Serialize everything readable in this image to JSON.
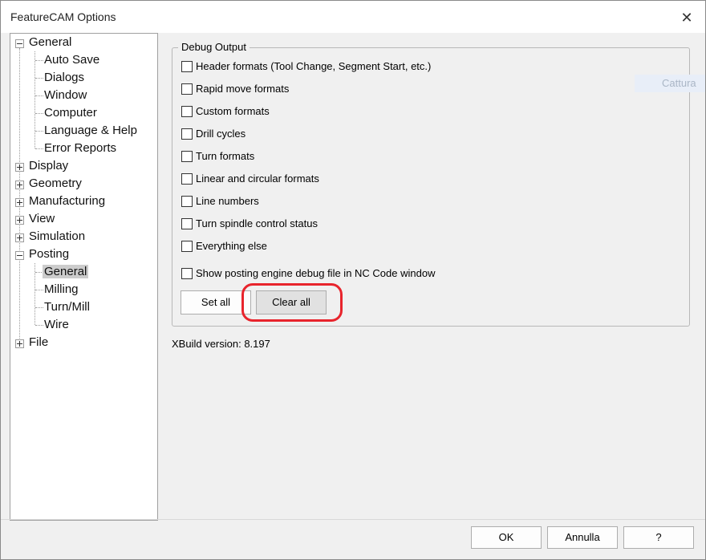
{
  "window": {
    "title": "FeatureCAM Options",
    "close_glyph": "✕"
  },
  "tree": {
    "general": "General",
    "general_children": [
      "Auto Save",
      "Dialogs",
      "Window",
      "Computer",
      "Language & Help",
      "Error Reports"
    ],
    "collapsed": [
      "Display",
      "Geometry",
      "Manufacturing",
      "View",
      "Simulation"
    ],
    "posting": "Posting",
    "posting_children": [
      "General",
      "Milling",
      "Turn/Mill",
      "Wire"
    ],
    "file": "File",
    "selected": "Posting > General"
  },
  "debug_output": {
    "legend": "Debug Output",
    "options": [
      {
        "label": "Header formats (Tool Change, Segment Start, etc.)",
        "checked": false
      },
      {
        "label": "Rapid move formats",
        "checked": false
      },
      {
        "label": "Custom formats",
        "checked": false
      },
      {
        "label": "Drill cycles",
        "checked": false
      },
      {
        "label": "Turn formats",
        "checked": false
      },
      {
        "label": "Linear and circular formats",
        "checked": false
      },
      {
        "label": "Line numbers",
        "checked": false
      },
      {
        "label": "Turn spindle control status",
        "checked": false
      },
      {
        "label": "Everything else",
        "checked": false
      }
    ],
    "nc_option": {
      "label": "Show posting engine debug file in NC Code window",
      "checked": false
    },
    "set_all": "Set all",
    "clear_all": "Clear all"
  },
  "xbuild": "XBuild version: 8.197",
  "overlay_text": "Cattura",
  "footer": {
    "ok": "OK",
    "cancel": "Annulla",
    "help": "?"
  },
  "colors": {
    "highlight": "#e8242c",
    "selection": "#cccccc"
  }
}
